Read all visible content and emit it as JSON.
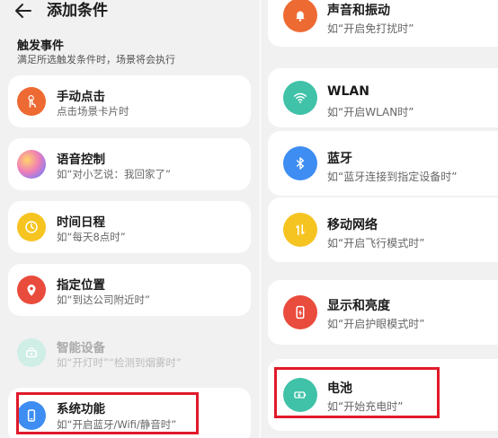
{
  "header": {
    "title": "添加条件"
  },
  "section": {
    "title": "触发事件",
    "subtitle": "满足所选触发条件时，场景将会执行"
  },
  "left_items": [
    {
      "label": "手动点击",
      "desc": "点击场景卡片时",
      "icon": "tap-icon",
      "color": "#ed6a32"
    },
    {
      "label": "语音控制",
      "desc": "如“对小艺说：我回家了”",
      "icon": "voice-assistant-icon",
      "color": "#c8a0f0"
    },
    {
      "label": "时间日程",
      "desc": "如“每天8点时”",
      "icon": "clock-icon",
      "color": "#f6c421"
    },
    {
      "label": "指定位置",
      "desc": "如“到达公司附近时”",
      "icon": "location-pin-icon",
      "color": "#e94b3c"
    },
    {
      "label": "智能设备",
      "desc": "如“开灯时”“检测到烟雾时”",
      "icon": "smart-device-icon",
      "color": "#bfe6dc"
    },
    {
      "label": "系统功能",
      "desc": "如“开启蓝牙/Wifi/静音时”",
      "icon": "phone-icon",
      "color": "#3d8df2"
    }
  ],
  "right_items": [
    {
      "label": "声音和振动",
      "desc": "如“开启免打扰时”",
      "icon": "bell-icon",
      "color": "#ed6a32"
    },
    {
      "label": "WLAN",
      "desc": "如“开启WLAN时”",
      "icon": "wifi-icon",
      "color": "#3fc2a8"
    },
    {
      "label": "蓝牙",
      "desc": "如“蓝牙连接到指定设备时”",
      "icon": "bluetooth-icon",
      "color": "#3d8df2"
    },
    {
      "label": "移动网络",
      "desc": "如“开启飞行模式时”",
      "icon": "mobile-data-icon",
      "color": "#f6c421"
    },
    {
      "label": "显示和亮度",
      "desc": "如“开启护眼模式时”",
      "icon": "display-icon",
      "color": "#e94b3c"
    },
    {
      "label": "电池",
      "desc": "如“开始充电时”",
      "icon": "battery-icon",
      "color": "#3fc2a8"
    }
  ],
  "highlight_color": "#e11a2a"
}
